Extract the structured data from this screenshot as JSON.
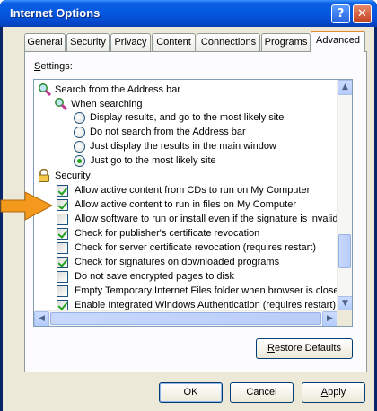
{
  "window": {
    "title": "Internet Options"
  },
  "titlebar_buttons": {
    "help": "?",
    "close": "✕"
  },
  "tabs": [
    {
      "label": "General"
    },
    {
      "label": "Security"
    },
    {
      "label": "Privacy"
    },
    {
      "label": "Content"
    },
    {
      "label": "Connections"
    },
    {
      "label": "Programs"
    },
    {
      "label": "Advanced"
    }
  ],
  "active_tab": "Advanced",
  "settings_label": "ettings:",
  "settings_label_accel": "S",
  "list": {
    "search_group": "Search from the Address bar",
    "when_searching": "When searching",
    "radios": [
      {
        "label": "Display results, and go to the most likely site",
        "checked": false
      },
      {
        "label": "Do not search from the Address bar",
        "checked": false
      },
      {
        "label": "Just display the results in the main window",
        "checked": false
      },
      {
        "label": "Just go to the most likely site",
        "checked": true
      }
    ],
    "security_group": "Security",
    "checks": [
      {
        "label": "Allow active content from CDs to run on My Computer",
        "checked": true
      },
      {
        "label": "Allow active content to run in files on My Computer",
        "checked": true
      },
      {
        "label": "Allow software to run or install even if the signature is invalid",
        "checked": false
      },
      {
        "label": "Check for publisher's certificate revocation",
        "checked": true
      },
      {
        "label": "Check for server certificate revocation (requires restart)",
        "checked": false
      },
      {
        "label": "Check for signatures on downloaded programs",
        "checked": true
      },
      {
        "label": "Do not save encrypted pages to disk",
        "checked": false
      },
      {
        "label": "Empty Temporary Internet Files folder when browser is closed",
        "checked": false
      },
      {
        "label": "Enable Integrated Windows Authentication (requires restart)",
        "checked": true
      }
    ]
  },
  "restore_defaults": {
    "accel": "R",
    "rest": "estore Defaults"
  },
  "footer": {
    "ok": "OK",
    "cancel": "Cancel",
    "apply_accel": "A",
    "apply_rest": "pply"
  },
  "colors": {
    "arrow": "#f39a1e",
    "check": "#21a121",
    "titlebar": "#0558e0"
  }
}
